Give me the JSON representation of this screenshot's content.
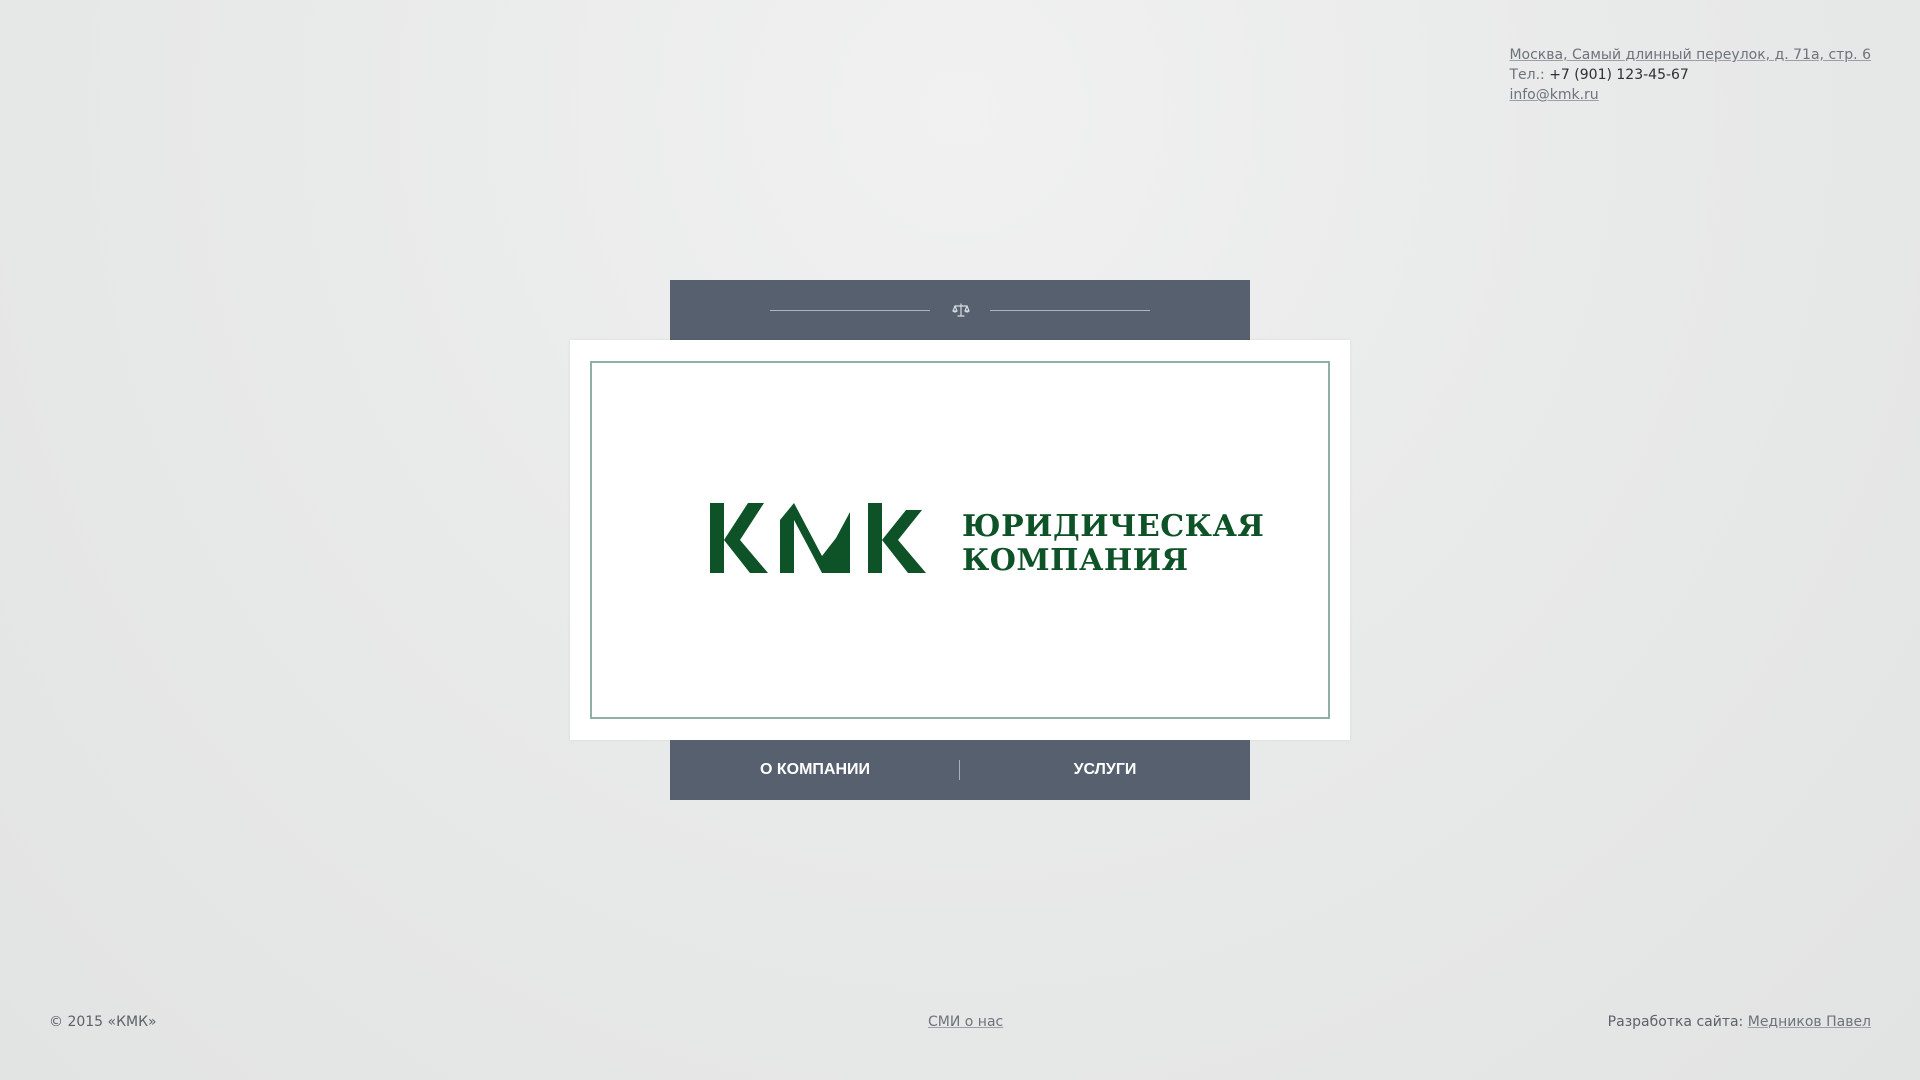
{
  "contacts": {
    "address": "Москва, Самый длинный переулок, д. 71а, стр. 6",
    "phone_label": "Тел.: ",
    "phone_value": "+7 (901) 123-45-67",
    "email": "info@kmk.ru"
  },
  "header": {
    "icon": "scales-icon"
  },
  "logo": {
    "mark_text": "КМК",
    "name_line1": "ЮРИДИЧЕСКАЯ",
    "name_line2": "КОМПАНИЯ",
    "brand_color": "#0e5227"
  },
  "nav": {
    "items": [
      {
        "label": "О КОМПАНИИ"
      },
      {
        "label": "УСЛУГИ"
      }
    ]
  },
  "footer": {
    "copyright": "© 2015 «КМК»",
    "media_link": "СМИ о нас",
    "dev_label": "Разработка сайта: ",
    "dev_name": "Медников Павел"
  },
  "colors": {
    "panel": "#56606e",
    "frame": "#8fb0a4",
    "background": "#e9eaea"
  }
}
